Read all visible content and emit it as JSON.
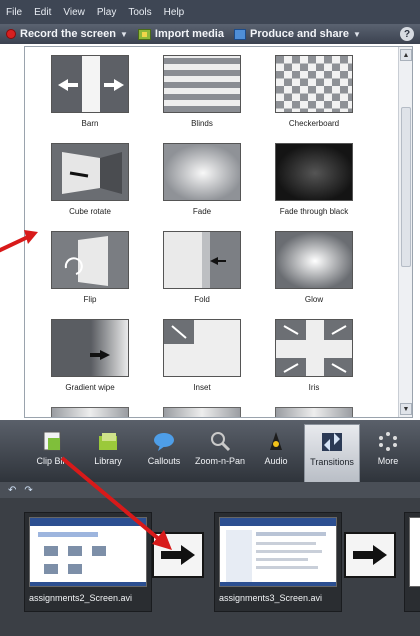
{
  "menu": [
    "File",
    "Edit",
    "View",
    "Play",
    "Tools",
    "Help"
  ],
  "toolbar": {
    "record": "Record the screen",
    "import": "Import media",
    "produce": "Produce and share",
    "help": "?"
  },
  "transitions": [
    {
      "label": "Barn",
      "icon": "barn-transition-icon"
    },
    {
      "label": "Blinds",
      "icon": "blinds-transition-icon"
    },
    {
      "label": "Checkerboard",
      "icon": "checkerboard-transition-icon"
    },
    {
      "label": "Cube rotate",
      "icon": "cube-rotate-transition-icon"
    },
    {
      "label": "Fade",
      "icon": "fade-transition-icon"
    },
    {
      "label": "Fade through black",
      "icon": "fade-black-transition-icon"
    },
    {
      "label": "Flip",
      "icon": "flip-transition-icon"
    },
    {
      "label": "Fold",
      "icon": "fold-transition-icon"
    },
    {
      "label": "Glow",
      "icon": "glow-transition-icon"
    },
    {
      "label": "Gradient wipe",
      "icon": "gradient-wipe-transition-icon"
    },
    {
      "label": "Inset",
      "icon": "inset-transition-icon"
    },
    {
      "label": "Iris",
      "icon": "iris-transition-icon"
    }
  ],
  "tabs": [
    {
      "label": "Clip Bin",
      "icon": "clip-bin-icon",
      "active": false
    },
    {
      "label": "Library",
      "icon": "library-icon",
      "active": false
    },
    {
      "label": "Callouts",
      "icon": "callouts-icon",
      "active": false
    },
    {
      "label": "Zoom-n-Pan",
      "icon": "zoom-icon",
      "active": false
    },
    {
      "label": "Audio",
      "icon": "audio-icon",
      "active": false
    },
    {
      "label": "Transitions",
      "icon": "transitions-icon",
      "active": true
    },
    {
      "label": "More",
      "icon": "more-icon",
      "active": false
    }
  ],
  "timeline": {
    "undo_icon": "undo-icon",
    "redo_icon": "redo-icon",
    "clips": [
      {
        "name": "assignments2_Screen.avi"
      },
      {
        "name": "assignments3_Screen.avi"
      }
    ]
  },
  "colors": {
    "annotation_arrow": "#d81a1a",
    "menubar": "#3e4654",
    "record_dot": "#d82020"
  }
}
